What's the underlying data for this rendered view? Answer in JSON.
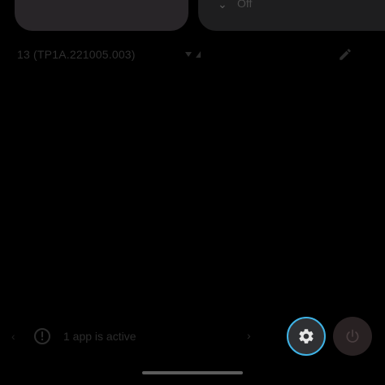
{
  "quick_settings": {
    "tile_right": {
      "icon": "chevron-down-icon",
      "label": "Off"
    }
  },
  "status": {
    "build_number": "13 (TP1A.221005.003)",
    "signal_icon": "signal-icon",
    "edit_icon": "pencil-icon"
  },
  "footer": {
    "active_apps_label": "1 app is active",
    "settings_icon": "gear-icon",
    "power_icon": "power-icon",
    "accent_color": "#3fb3e6"
  }
}
